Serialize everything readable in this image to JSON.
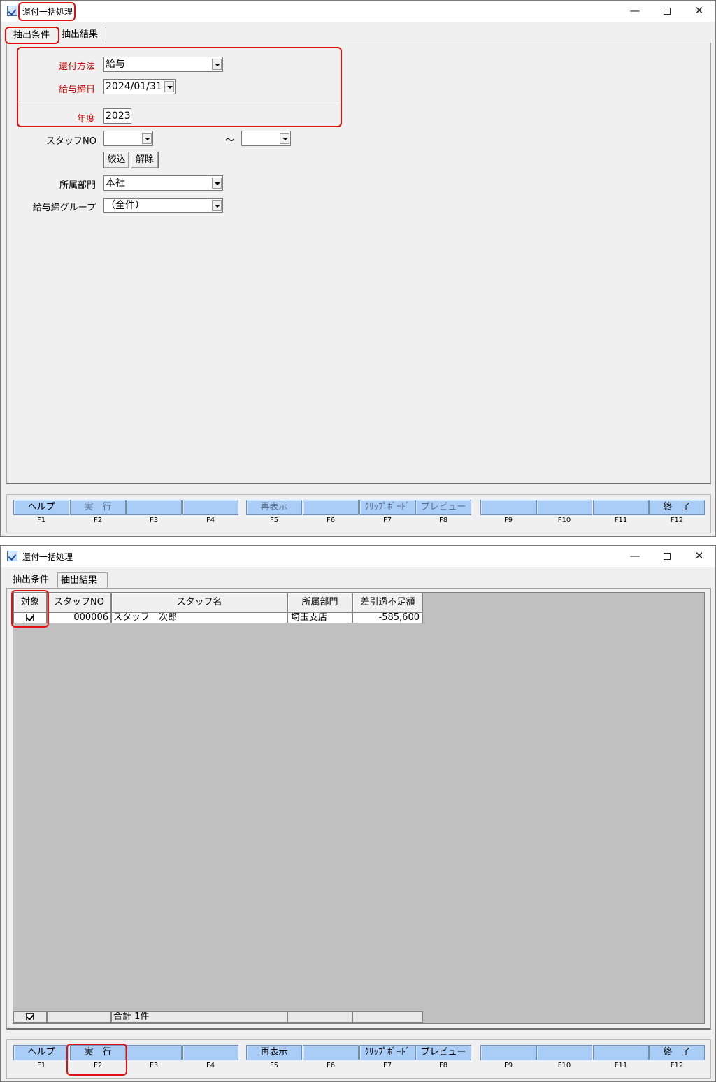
{
  "window": {
    "title": "還付一括処理",
    "minimize_glyph": "—",
    "close_glyph": "✕"
  },
  "tabs": {
    "conditions": "抽出条件",
    "results": "抽出結果"
  },
  "conditions": {
    "refund_method_label": "還付方法",
    "refund_method_value": "給与",
    "payroll_date_label": "給与締日",
    "payroll_date_value": "2024/01/31",
    "year_label": "年度",
    "year_value": "2023",
    "staff_no_label": "スタッフNO",
    "staff_no_from": "",
    "range_sep": "～",
    "staff_no_to": "",
    "filter_button": "絞込",
    "clear_button": "解除",
    "dept_label": "所属部門",
    "dept_value": "本社",
    "group_label": "給与締グループ",
    "group_value": "（全件）"
  },
  "grid": {
    "columns": [
      "対象",
      "スタッフNO",
      "スタッフ名",
      "所属部門",
      "差引過不足額"
    ],
    "rows": [
      {
        "checked": true,
        "staff_no": "000006",
        "staff_name": "スタッフ　次郎",
        "dept": "埼玉支店",
        "amount": "-585,600"
      }
    ],
    "footer": {
      "checked": true,
      "total_label": "合計 1件"
    }
  },
  "fkeys": [
    {
      "label": "ヘルプ",
      "key": "F1"
    },
    {
      "label": "実　行",
      "key": "F2"
    },
    {
      "label": "",
      "key": "F3"
    },
    {
      "label": "",
      "key": "F4"
    },
    {
      "label": "再表示",
      "key": "F5"
    },
    {
      "label": "",
      "key": "F6"
    },
    {
      "label": "ｸﾘｯﾌﾟﾎﾞｰﾄﾞ",
      "key": "F7"
    },
    {
      "label": "プレビュー",
      "key": "F8"
    },
    {
      "label": "",
      "key": "F9"
    },
    {
      "label": "",
      "key": "F10"
    },
    {
      "label": "",
      "key": "F11"
    },
    {
      "label": "終　了",
      "key": "F12"
    }
  ],
  "colors": {
    "highlight": "#e01010",
    "required_label": "#c00000",
    "fkey_bg": "#a9cdf7",
    "grid_bg": "#c0c0c0"
  }
}
